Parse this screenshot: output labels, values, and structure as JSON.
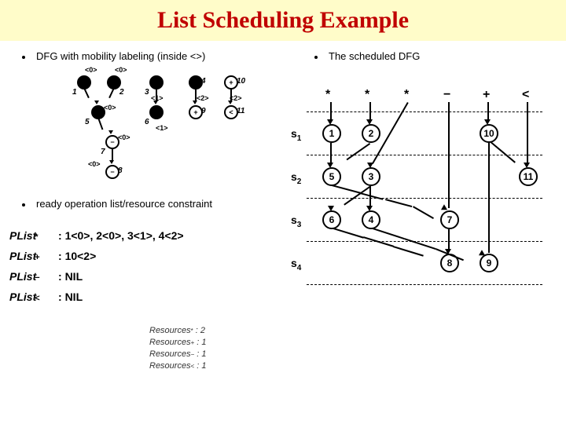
{
  "title": "List Scheduling Example",
  "bullets": {
    "dfg_mobility": "DFG with mobility labeling (inside <>)",
    "scheduled": "The scheduled DFG",
    "ready_list": "ready operation list/resource constraint"
  },
  "mobility_graph": {
    "nodes": [
      {
        "id": "1",
        "op": "*",
        "mob": "<0>"
      },
      {
        "id": "2",
        "op": "*",
        "mob": "<0>"
      },
      {
        "id": "3",
        "op": "*",
        "mob": "<1>"
      },
      {
        "id": "4",
        "op": "*",
        "mob": "<2>"
      },
      {
        "id": "5",
        "op": "*",
        "mob": "<0>"
      },
      {
        "id": "6",
        "op": "*",
        "mob": "<1>"
      },
      {
        "id": "7",
        "op": "-",
        "mob": "<0>"
      },
      {
        "id": "8",
        "op": "-",
        "mob": "<0>"
      },
      {
        "id": "9",
        "op": "+",
        "mob": "<2>"
      },
      {
        "id": "10",
        "op": "+",
        "mob": "<2>"
      },
      {
        "id": "11",
        "op": "<",
        "mob": "<2>"
      }
    ]
  },
  "plist": [
    {
      "sub": "*",
      "items": "1<0>, 2<0>, 3<1>, 4<2>"
    },
    {
      "sub": "+",
      "items": "10<2>"
    },
    {
      "sub": "−",
      "items": "NIL"
    },
    {
      "sub": "<",
      "items": "NIL"
    }
  ],
  "plist_label": "PList",
  "resources": [
    {
      "sub": "*",
      "val": "2"
    },
    {
      "sub": "+",
      "val": "1"
    },
    {
      "sub": "−",
      "val": "1"
    },
    {
      "sub": "<",
      "val": "1"
    }
  ],
  "resources_label": "Resources",
  "scheduled_graph": {
    "op_header": [
      "*",
      "*",
      "*",
      "−",
      "+",
      "<"
    ],
    "steps": [
      "s₁",
      "s₂",
      "s₃",
      "s₄"
    ],
    "nodes": [
      {
        "id": "1",
        "op": "*"
      },
      {
        "id": "2",
        "op": "*"
      },
      {
        "id": "10",
        "op": "+"
      },
      {
        "id": "5",
        "op": "*"
      },
      {
        "id": "3",
        "op": "*"
      },
      {
        "id": "11",
        "op": "<"
      },
      {
        "id": "6",
        "op": "*"
      },
      {
        "id": "4",
        "op": "*"
      },
      {
        "id": "7",
        "op": "−"
      },
      {
        "id": "8",
        "op": "−"
      },
      {
        "id": "9",
        "op": "+"
      }
    ]
  }
}
